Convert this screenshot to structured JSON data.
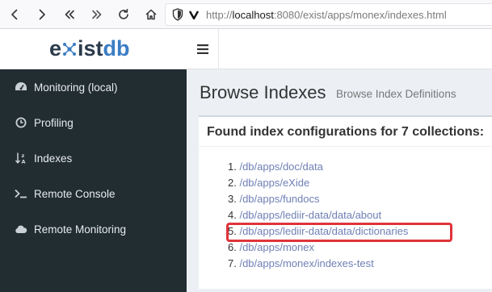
{
  "browser": {
    "url_prefix": "http://",
    "url_host": "localhost",
    "url_rest": ":8080/exist/apps/monex/indexes.html",
    "icons": [
      "back-icon",
      "forward-icon",
      "first-page-icon",
      "last-page-icon",
      "reload-icon",
      "home-icon",
      "shield-icon",
      "tracking-icon"
    ]
  },
  "logo": {
    "part1": "e",
    "part2": "ist",
    "part3": "db"
  },
  "sidebar": {
    "items": [
      {
        "label": "Monitoring (local)",
        "icon": "dashboard-icon"
      },
      {
        "label": "Profiling",
        "icon": "clock-icon"
      },
      {
        "label": "Indexes",
        "icon": "sort-alpha-icon"
      },
      {
        "label": "Remote Console",
        "icon": "terminal-icon"
      },
      {
        "label": "Remote Monitoring",
        "icon": "cloud-icon"
      }
    ]
  },
  "page": {
    "title": "Browse Indexes",
    "subtitle": "Browse Index Definitions"
  },
  "box": {
    "title": "Found index configurations for 7 collections:",
    "collections": [
      {
        "num": "1.",
        "path": "/db/apps/doc/data"
      },
      {
        "num": "2.",
        "path": "/db/apps/eXide"
      },
      {
        "num": "3.",
        "path": "/db/apps/fundocs"
      },
      {
        "num": "4.",
        "path": "/db/apps/lediir-data/data/about"
      },
      {
        "num": "5.",
        "path": "/db/apps/lediir-data/data/dictionaries"
      },
      {
        "num": "6.",
        "path": "/db/apps/monex"
      },
      {
        "num": "7.",
        "path": "/db/apps/monex/indexes-test"
      }
    ]
  },
  "colors": {
    "sidebar_bg": "#222d32",
    "content_bg": "#ecf0f5",
    "link": "#6f7fb5",
    "highlight": "#e0333a"
  }
}
